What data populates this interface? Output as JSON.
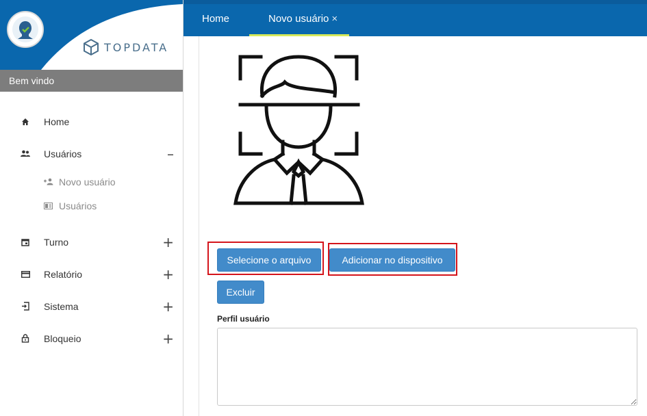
{
  "sidebar": {
    "brand": "TOPDATA",
    "welcome": "Bem vindo",
    "items": [
      {
        "label": "Home",
        "icon": "home-icon",
        "toggle": ""
      },
      {
        "label": "Usuários",
        "icon": "users-icon",
        "toggle": "–"
      },
      {
        "label": "Turno",
        "icon": "calendar-icon",
        "toggle": "+"
      },
      {
        "label": "Relatório",
        "icon": "report-icon",
        "toggle": "+"
      },
      {
        "label": "Sistema",
        "icon": "system-icon",
        "toggle": "+"
      },
      {
        "label": "Bloqueio",
        "icon": "lock-icon",
        "toggle": "+"
      }
    ],
    "subitems": [
      {
        "label": "Novo usuário",
        "icon": "user-add-icon"
      },
      {
        "label": "Usuários",
        "icon": "id-card-icon"
      }
    ]
  },
  "tabs": [
    {
      "label": "Home"
    },
    {
      "label": "Novo usuário",
      "close": "×",
      "active": true
    }
  ],
  "main": {
    "buttons": {
      "select_file": "Selecione o arquivo",
      "add_device": "Adicionar no dispositivo",
      "delete": "Excluir"
    },
    "profile_label": "Perfil usuário",
    "profile_value": ""
  },
  "colors": {
    "header_blue": "#0a67ad",
    "button_blue": "#428bca",
    "tab_underline": "#d6e95a",
    "highlight_red": "#d4141b"
  }
}
